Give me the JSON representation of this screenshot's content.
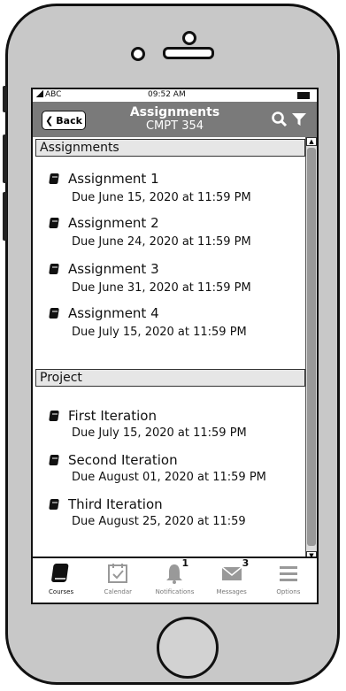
{
  "status": {
    "carrier": "ABC",
    "time": "09:52 AM"
  },
  "nav": {
    "back_label": "Back",
    "title": "Assignments",
    "subtitle": "CMPT 354"
  },
  "sections": {
    "assignments": {
      "header": "Assignments",
      "items": [
        {
          "title": "Assignment 1",
          "due": "Due June 15, 2020 at 11:59 PM"
        },
        {
          "title": "Assignment 2",
          "due": "Due June 24, 2020 at 11:59 PM"
        },
        {
          "title": "Assignment 3",
          "due": "Due June 31, 2020 at 11:59 PM"
        },
        {
          "title": "Assignment 4",
          "due": "Due July 15, 2020 at 11:59 PM"
        }
      ]
    },
    "project": {
      "header": "Project",
      "items": [
        {
          "title": "First Iteration",
          "due": "Due July 15, 2020 at 11:59 PM"
        },
        {
          "title": "Second Iteration",
          "due": "Due August 01, 2020 at 11:59 PM"
        },
        {
          "title": "Third Iteration",
          "due": "Due August 25, 2020 at 11:59"
        }
      ]
    }
  },
  "tabs": [
    {
      "label": "Courses",
      "icon": "book-icon",
      "active": true
    },
    {
      "label": "Calendar",
      "icon": "calendar-icon"
    },
    {
      "label": "Notifications",
      "icon": "bell-icon",
      "badge": "1"
    },
    {
      "label": "Messages",
      "icon": "envelope-icon",
      "badge": "3"
    },
    {
      "label": "Options",
      "icon": "menu-icon"
    }
  ]
}
